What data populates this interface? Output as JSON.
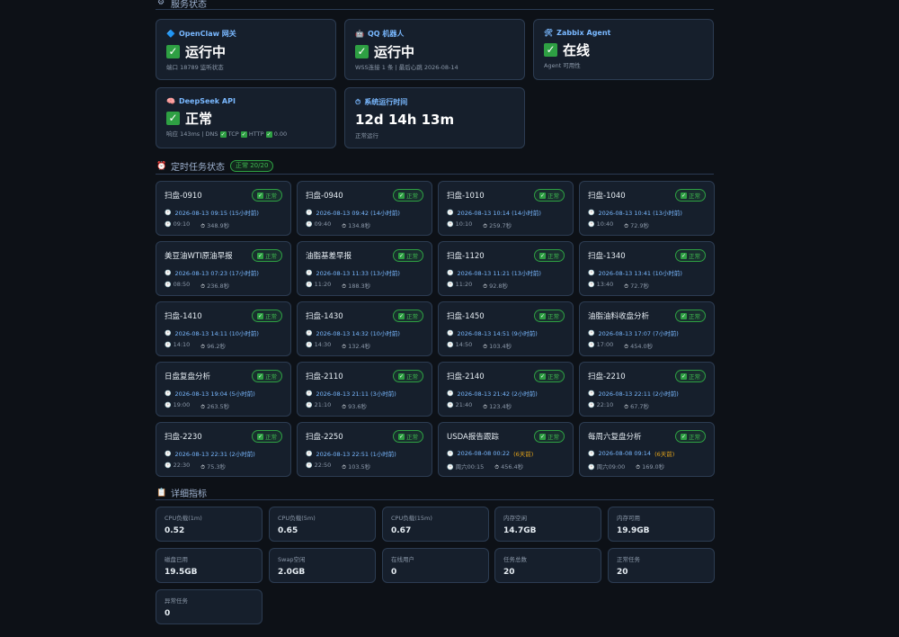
{
  "sections": {
    "service": {
      "icon": "⚙",
      "title": "服务状态"
    },
    "tasks": {
      "icon": "⏰",
      "title": "定时任务状态",
      "pill": "正常 20/20"
    },
    "metrics": {
      "icon": "📋",
      "title": "详细指标"
    }
  },
  "services": [
    {
      "icon": "🔷",
      "icon_name": "diamond-icon",
      "title": "OpenClaw 网关",
      "status": "运行中",
      "sub": "端口 18789 监听状态"
    },
    {
      "icon": "🤖",
      "icon_name": "robot-icon",
      "title": "QQ 机器人",
      "status": "运行中",
      "sub": "WSS连接 1 条 | 最后心跳 2026-08-14"
    },
    {
      "icon": "🛠",
      "icon_name": "tool-icon",
      "title": "Zabbix Agent",
      "status": "在线",
      "sub": "Agent 可用性"
    },
    {
      "icon": "🧠",
      "icon_name": "brain-icon",
      "title": "DeepSeek API",
      "status": "正常",
      "sub_parts": [
        "响应 143ms | DNS",
        "TCP",
        "HTTP",
        "0.00"
      ]
    },
    {
      "icon": "⏱",
      "icon_name": "stopwatch-icon",
      "title": "系统运行时间",
      "uptime": "12d 14h 13m",
      "sub": "正常运行"
    }
  ],
  "check_glyph": "✓",
  "tasks": [
    {
      "name": "扫盘-0910",
      "badge": "正常",
      "time": "2026-08-13 09:15 (15小时前)",
      "sched": "09:10",
      "dur": "348.9秒"
    },
    {
      "name": "扫盘-0940",
      "badge": "正常",
      "time": "2026-08-13 09:42 (14小时前)",
      "sched": "09:40",
      "dur": "134.8秒"
    },
    {
      "name": "扫盘-1010",
      "badge": "正常",
      "time": "2026-08-13 10:14 (14小时前)",
      "sched": "10:10",
      "dur": "259.7秒"
    },
    {
      "name": "扫盘-1040",
      "badge": "正常",
      "time": "2026-08-13 10:41 (13小时前)",
      "sched": "10:40",
      "dur": "72.9秒"
    },
    {
      "name": "美豆油WTI原油早报",
      "badge": "正常",
      "time": "2026-08-13 07:23 (17小时前)",
      "sched": "08:50",
      "dur": "236.8秒"
    },
    {
      "name": "油脂基差早报",
      "badge": "正常",
      "time": "2026-08-13 11:33 (13小时前)",
      "sched": "11:20",
      "dur": "188.3秒"
    },
    {
      "name": "扫盘-1120",
      "badge": "正常",
      "time": "2026-08-13 11:21 (13小时前)",
      "sched": "11:20",
      "dur": "92.8秒"
    },
    {
      "name": "扫盘-1340",
      "badge": "正常",
      "time": "2026-08-13 13:41 (10小时前)",
      "sched": "13:40",
      "dur": "72.7秒"
    },
    {
      "name": "扫盘-1410",
      "badge": "正常",
      "time": "2026-08-13 14:11 (10小时前)",
      "sched": "14:10",
      "dur": "96.2秒"
    },
    {
      "name": "扫盘-1430",
      "badge": "正常",
      "time": "2026-08-13 14:32 (10小时前)",
      "sched": "14:30",
      "dur": "132.4秒"
    },
    {
      "name": "扫盘-1450",
      "badge": "正常",
      "time": "2026-08-13 14:51 (9小时前)",
      "sched": "14:50",
      "dur": "103.4秒"
    },
    {
      "name": "油脂油料收盘分析",
      "badge": "正常",
      "time": "2026-08-13 17:07 (7小时前)",
      "sched": "17:00",
      "dur": "454.0秒"
    },
    {
      "name": "日盘复盘分析",
      "badge": "正常",
      "time": "2026-08-13 19:04 (5小时前)",
      "sched": "19:00",
      "dur": "263.5秒"
    },
    {
      "name": "扫盘-2110",
      "badge": "正常",
      "time": "2026-08-13 21:11 (3小时前)",
      "sched": "21:10",
      "dur": "93.6秒"
    },
    {
      "name": "扫盘-2140",
      "badge": "正常",
      "time": "2026-08-13 21:42 (2小时前)",
      "sched": "21:40",
      "dur": "123.4秒"
    },
    {
      "name": "扫盘-2210",
      "badge": "正常",
      "time": "2026-08-13 22:11 (2小时前)",
      "sched": "22:10",
      "dur": "67.7秒"
    },
    {
      "name": "扫盘-2230",
      "badge": "正常",
      "time": "2026-08-13 22:31 (2小时前)",
      "sched": "22:30",
      "dur": "75.3秒"
    },
    {
      "name": "扫盘-2250",
      "badge": "正常",
      "time": "2026-08-13 22:51 (1小时前)",
      "sched": "22:50",
      "dur": "103.5秒"
    },
    {
      "name": "USDA报告跟踪",
      "badge": "正常",
      "time": "2026-08-08 00:22",
      "warn": "(6天前)",
      "sched": "周六00:15",
      "dur": "456.4秒"
    },
    {
      "name": "每周六复盘分析",
      "badge": "正常",
      "time": "2026-08-08 09:14",
      "warn": "(6天前)",
      "sched": "周六09:00",
      "dur": "169.0秒"
    }
  ],
  "metrics": [
    {
      "label": "CPU负载(1m)",
      "value": "0.52"
    },
    {
      "label": "CPU负载(5m)",
      "value": "0.65"
    },
    {
      "label": "CPU负载(15m)",
      "value": "0.67"
    },
    {
      "label": "内存空闲",
      "value": "14.7GB"
    },
    {
      "label": "内存可用",
      "value": "19.9GB"
    },
    {
      "label": "磁盘已用",
      "value": "19.5GB"
    },
    {
      "label": "Swap空闲",
      "value": "2.0GB"
    },
    {
      "label": "在线用户",
      "value": "0"
    },
    {
      "label": "任务总数",
      "value": "20"
    },
    {
      "label": "正常任务",
      "value": "20"
    },
    {
      "label": "异常任务",
      "value": "0"
    }
  ]
}
